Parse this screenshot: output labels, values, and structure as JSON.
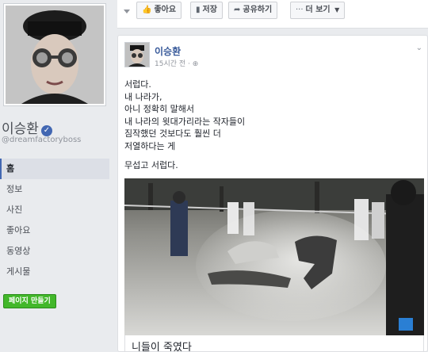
{
  "profile": {
    "name": "이승환",
    "handle": "@dreamfactoryboss",
    "verified_icon": "verified-check-icon"
  },
  "nav": {
    "items": [
      {
        "label": "홈",
        "active": true
      },
      {
        "label": "정보"
      },
      {
        "label": "사진"
      },
      {
        "label": "좋아요"
      },
      {
        "label": "동영상"
      },
      {
        "label": "게시물"
      }
    ],
    "create_page_label": "페이지 만들기"
  },
  "action_bar": {
    "like_label": "좋아요",
    "save_label": "저장",
    "share_label": "공유하기",
    "more_label": "더 보기"
  },
  "post": {
    "author": "이승환",
    "time": "15시간 전 · ",
    "lines": [
      "서럽다.",
      "내 나라가,",
      "아니 정확히 말해서",
      "내 나라의 윗대가리라는 작자들이",
      "짐작했던 것보다도 훨씬 더",
      "저열하다는 게",
      "무섭고 서럽다."
    ],
    "link_title": "니들이 죽였다"
  },
  "colors": {
    "accent": "#4267b2",
    "link": "#365899",
    "green": "#42b72a",
    "bg": "#e9ebee"
  }
}
